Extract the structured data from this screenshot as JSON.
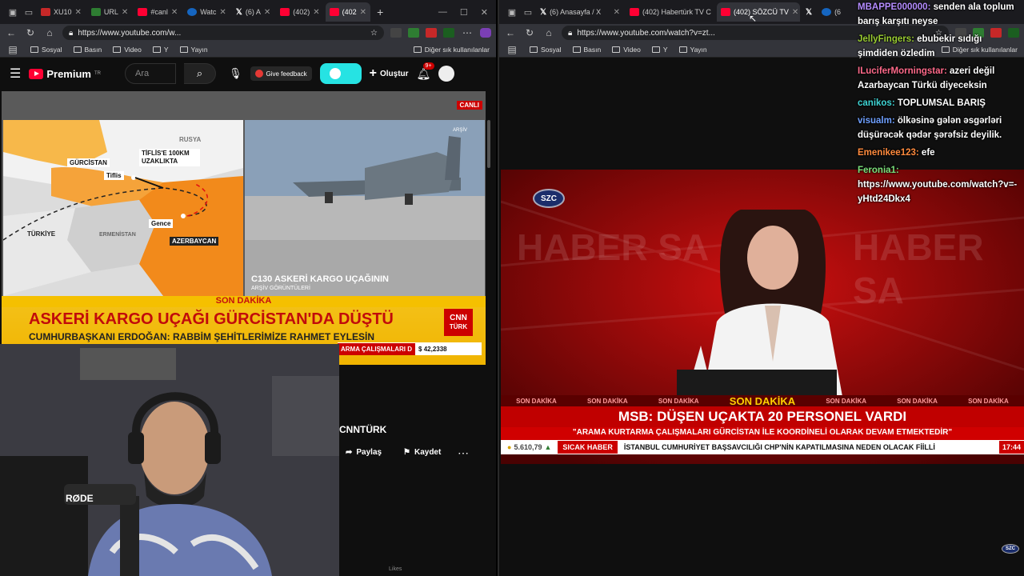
{
  "left": {
    "tabs": [
      {
        "icon": "f",
        "label": "XU10"
      },
      {
        "icon": "g",
        "label": "URL"
      },
      {
        "icon": "yt",
        "label": "#canl"
      },
      {
        "icon": "b",
        "label": "Watc"
      },
      {
        "icon": "x",
        "label": "(6) A"
      },
      {
        "icon": "yt",
        "label": "(402)"
      },
      {
        "icon": "yt",
        "label": "(402",
        "active": true
      }
    ],
    "url": "https://www.youtube.com/w...",
    "bookmarks": [
      "Sosyal",
      "Basın",
      "Video",
      "Y",
      "Yayın"
    ],
    "bookmarks_right": "Diğer sık kullanılanlar",
    "yt": {
      "logo": "Premium",
      "region": "TR",
      "search_placeholder": "Ara",
      "feedback": "Give feedback",
      "create": "Oluştur",
      "notifications": "9+"
    },
    "video": {
      "live_badge": "CANLI",
      "map_labels": {
        "rusya": "RUSYA",
        "gurcistan": "GÜRCİSTAN",
        "tiflis": "Tiflis",
        "distance": "TİFLİS'E 100KM UZAKLIKTA",
        "gence": "Gence",
        "turkiye": "TÜRKİYE",
        "ermenistan": "ERMENİSTAN",
        "azerbaycan": "AZERBAYCAN"
      },
      "archive_tag": "ARŞİV",
      "plane_caption": "C130 ASKERİ KARGO UÇAĞININ",
      "plane_subcaption": "ARŞİV GÖRÜNTÜLERİ",
      "son_dakika": "SON DAKİKA",
      "headline": "ASKERİ KARGO UÇAĞI GÜRCİSTAN'DA DÜŞTÜ",
      "subheadline": "CUMHURBAŞKANI ERDOĞAN: RABBİM ŞEHİTLERİMİZE RAHMET EYLESİN",
      "channel_logo": "CNN",
      "channel_logo_sub": "TÜRK",
      "ticker_red": "ARMA ÇALIŞMALARI D",
      "ticker_value": "$ 42,2338"
    },
    "channel_name": "CNNTÜRK",
    "share": "Paylaş",
    "save": "Kaydet",
    "mic_brand": "RØDE",
    "likes": "Likes"
  },
  "right": {
    "tabs": [
      {
        "icon": "x",
        "label": "(6) Anasayfa / X"
      },
      {
        "icon": "yt",
        "label": "(402) Habertürk TV C"
      },
      {
        "icon": "yt",
        "label": "(402) SÖZCÜ TV",
        "active": true
      },
      {
        "icon": "x",
        "label": ""
      },
      {
        "icon": "b",
        "label": "(6"
      }
    ],
    "url": "https://www.youtube.com/watch?v=zt...",
    "bookmarks": [
      "Sosyal",
      "Basın",
      "Video",
      "Y",
      "Yayın"
    ],
    "bookmarks_right": "Diğer sık kullanılanlar",
    "tv": {
      "logo": "SZC",
      "bg_text": "HABER SA",
      "son_dakika": "SON DAKİKA",
      "headline": "MSB: DÜŞEN UÇAKTA 20 PERSONEL VARDI",
      "subheadline": "\"ARAMA KURTARMA ÇALIŞMALARI GÜRCİSTAN İLE KOORDİNELİ OLARAK DEVAM ETMEKTEDİR\"",
      "coin_value": "5.610,79",
      "coin_arrow": "▲",
      "sicak": "SICAK HABER",
      "news": "İSTANBUL CUMHURİYET BAŞSAVCILIĞI CHP'NİN KAPATILMASINA NEDEN OLACAK FİİLLİ",
      "time": "17:44"
    }
  },
  "chat": [
    {
      "user": "MBAPPE000000:",
      "text": "senden ala toplum barış karşıtı neyse",
      "color": "#b48cff"
    },
    {
      "user": "JellyFingers:",
      "text": "ebubekir sıdığı şimdiden özledim",
      "color": "#9acd32"
    },
    {
      "user": "ILuciferMorningstar:",
      "text": "azeri değil Azarbaycan Türkü diyeceksin",
      "color": "#ff6a8a"
    },
    {
      "user": "canikos:",
      "text": "TOPLUMSAL BARIŞ",
      "color": "#3fd4d4"
    },
    {
      "user": "visualm:",
      "text": "ölkəsinə gələn əsgərləri düşürəcək qədər şərəfsiz deyilik.",
      "color": "#6fa0ff"
    },
    {
      "user": "Emenikee123:",
      "text": "efe",
      "color": "#ff8a3d"
    },
    {
      "user": "Feronia1:",
      "text": "https://www.youtube.com/watch?v=-yHtd24Dkx4",
      "color": "#7be07b"
    }
  ]
}
